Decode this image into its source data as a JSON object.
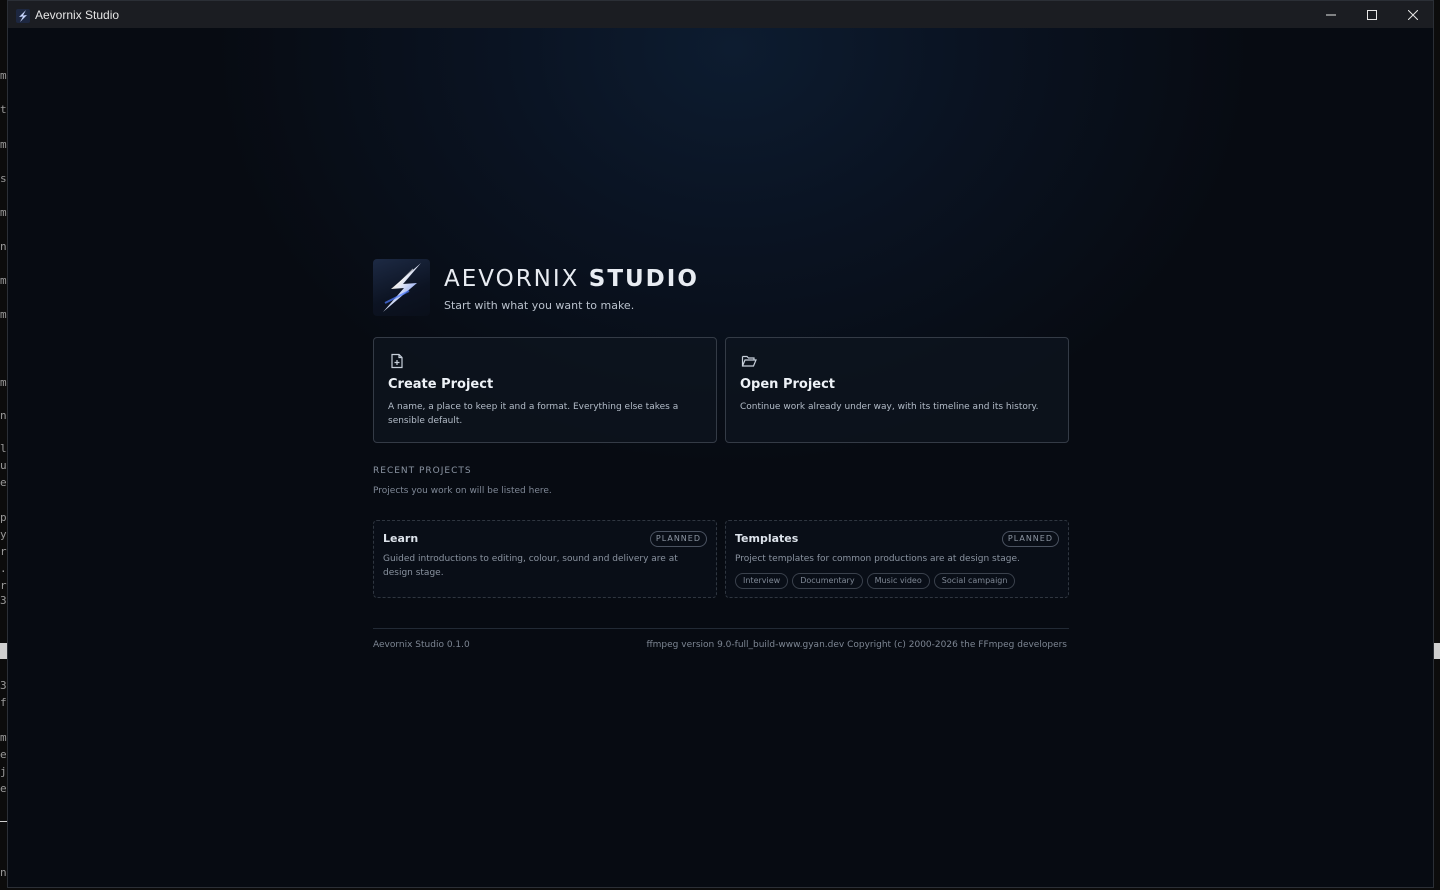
{
  "window": {
    "title": "Aevornix Studio"
  },
  "brand": {
    "name_light": "AEVORNIX",
    "name_bold": "STUDIO",
    "tagline": "Start with what you want to make."
  },
  "actions": {
    "create": {
      "title": "Create Project",
      "description": "A name, a place to keep it and a format. Everything else takes a sensible default.",
      "icon": "file-plus-icon"
    },
    "open": {
      "title": "Open Project",
      "description": "Continue work already under way, with its timeline and its history.",
      "icon": "folder-open-icon"
    }
  },
  "recent": {
    "label": "RECENT PROJECTS",
    "empty_note": "Projects you work on will be listed here."
  },
  "planned": {
    "learn": {
      "title": "Learn",
      "badge": "PLANNED",
      "description": "Guided introductions to editing, colour, sound and delivery are at design stage."
    },
    "templates": {
      "title": "Templates",
      "badge": "PLANNED",
      "description": "Project templates for common productions are at design stage.",
      "chips": [
        "Interview",
        "Documentary",
        "Music video",
        "Social campaign"
      ]
    }
  },
  "footer": {
    "version": "Aevornix Studio 0.1.0",
    "ffmpeg": "ffmpeg version 9.0-full_build-www.gyan.dev Copyright (c) 2000-2026 the FFmpeg developers"
  },
  "background_terminal": {
    "glyphs": [
      "m",
      "t",
      "m",
      "s",
      "m",
      "n",
      "m",
      "m",
      "m",
      "n",
      "l",
      "u",
      "e",
      "p",
      "y",
      "r",
      ".",
      "r",
      "3",
      "3",
      "f",
      "m",
      "e",
      "j",
      "e",
      "n"
    ]
  },
  "colors": {
    "accent": "#3b82f6",
    "background": "#070b12",
    "card_border": "#343b46"
  }
}
